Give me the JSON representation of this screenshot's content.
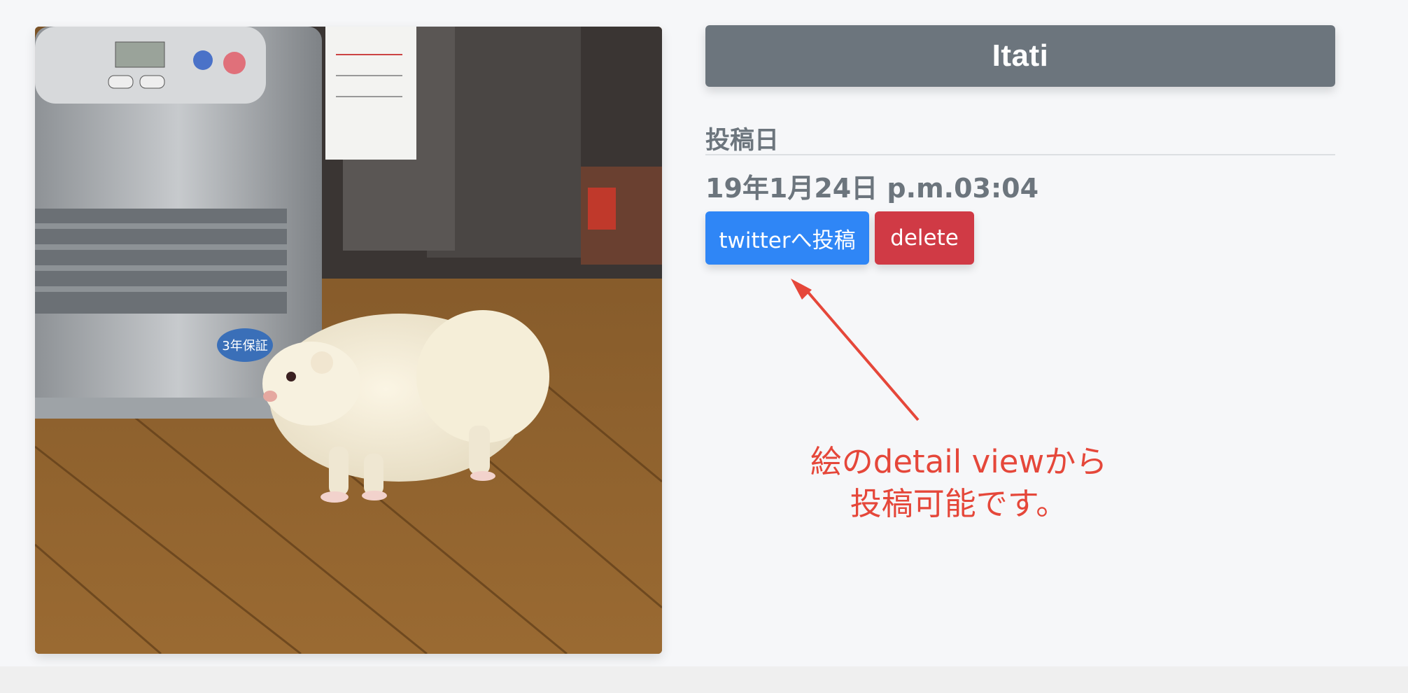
{
  "post": {
    "title": "Itati",
    "date_label": "投稿日",
    "date_value": "19年1月24日 p.m.03:04"
  },
  "buttons": {
    "twitter_label": "twitterへ投稿",
    "delete_label": "delete"
  },
  "annotation": {
    "line1": "絵のdetail viewから",
    "line2": "投稿可能です。"
  },
  "photo": {
    "subject": "ferret-photo",
    "heater_badge": "3年保証"
  },
  "colors": {
    "title_bg": "#6c757d",
    "twitter_button": "#2f86f6",
    "delete_button": "#d03a45",
    "annotation": "#e5473a"
  }
}
